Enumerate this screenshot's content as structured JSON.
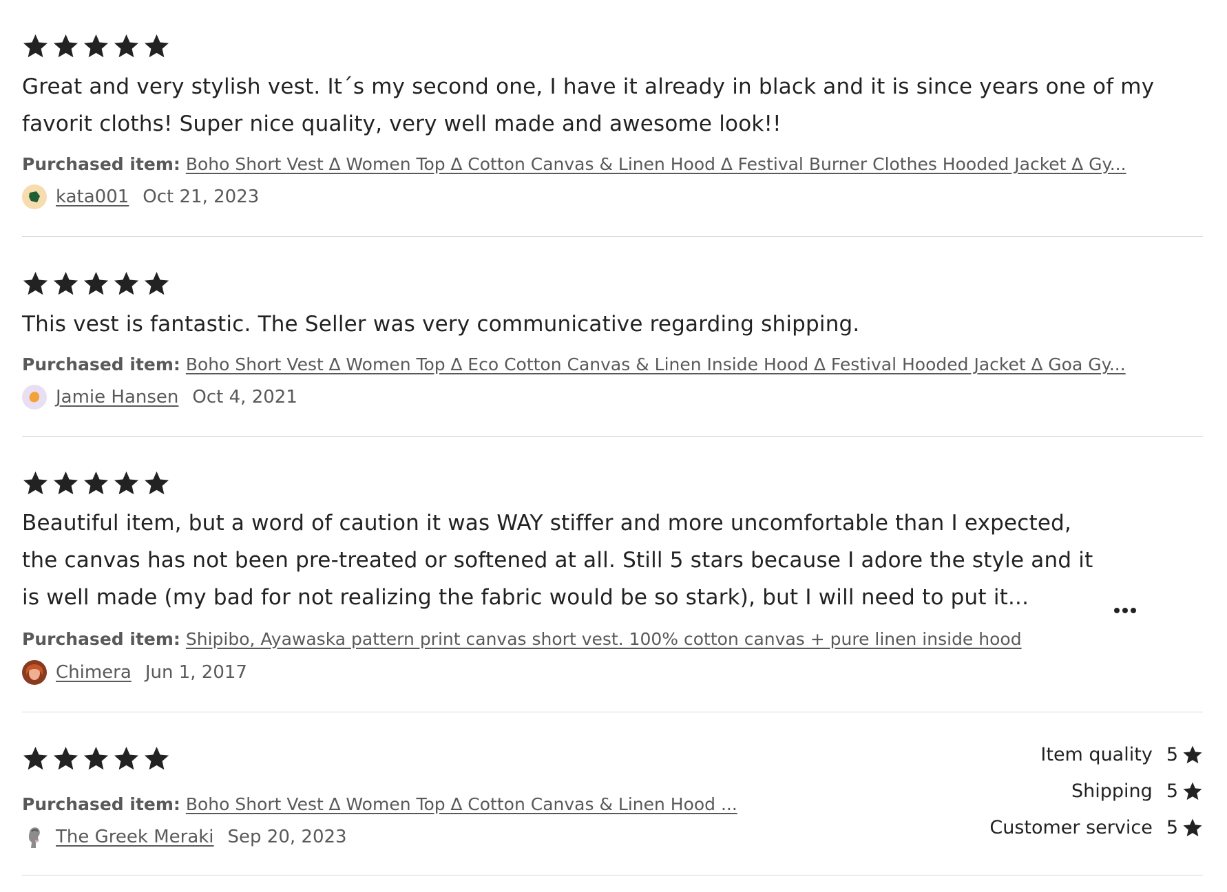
{
  "labels": {
    "purchased_item": "Purchased item:"
  },
  "reviews": [
    {
      "rating": 5,
      "text": "Great and very stylish vest. It´s my second one, I have it already in black and it is since years one of my favorit cloths! Super nice quality, very well made and awesome look!!",
      "purchased_item": "Boho Short Vest ∆ Women Top ∆ Cotton Canvas & Linen Hood ∆ Festival Burner Clothes Hooded Jacket ∆ Gy...",
      "reviewer": "kata001",
      "date": "Oct 21, 2023"
    },
    {
      "rating": 5,
      "text": "This vest is fantastic. The Seller was very communicative regarding shipping.",
      "purchased_item": "Boho Short Vest ∆ Women Top ∆ Eco Cotton Canvas & Linen Inside Hood ∆ Festival Hooded Jacket ∆ Goa Gy...",
      "reviewer": "Jamie Hansen",
      "date": "Oct 4, 2021"
    },
    {
      "rating": 5,
      "text": "Beautiful item, but a word of caution it was WAY stiffer and more uncomfortable than I expected, the canvas has not been pre-treated or softened at all. Still 5 stars because I adore the style and it is well made (my bad for not realizing the fabric would be so stark), but I will need to put it...",
      "purchased_item": "Shipibo, Ayawaska pattern print canvas short vest. 100% cotton canvas + pure linen inside hood",
      "reviewer": "Chimera",
      "date": "Jun 1, 2017"
    },
    {
      "rating": 5,
      "text": "",
      "purchased_item": "Boho Short Vest ∆ Women Top ∆ Cotton Canvas & Linen Hood ...",
      "reviewer": "The Greek Meraki",
      "date": "Sep 20, 2023",
      "sub_ratings": [
        {
          "label": "Item quality",
          "value": "5"
        },
        {
          "label": "Shipping",
          "value": "5"
        },
        {
          "label": "Customer service",
          "value": "5"
        }
      ]
    }
  ],
  "icons": {
    "star": "star-icon",
    "more": "more-options-icon"
  },
  "colors": {
    "text": "#222222",
    "muted": "#595959",
    "divider": "#d8d8d8"
  }
}
